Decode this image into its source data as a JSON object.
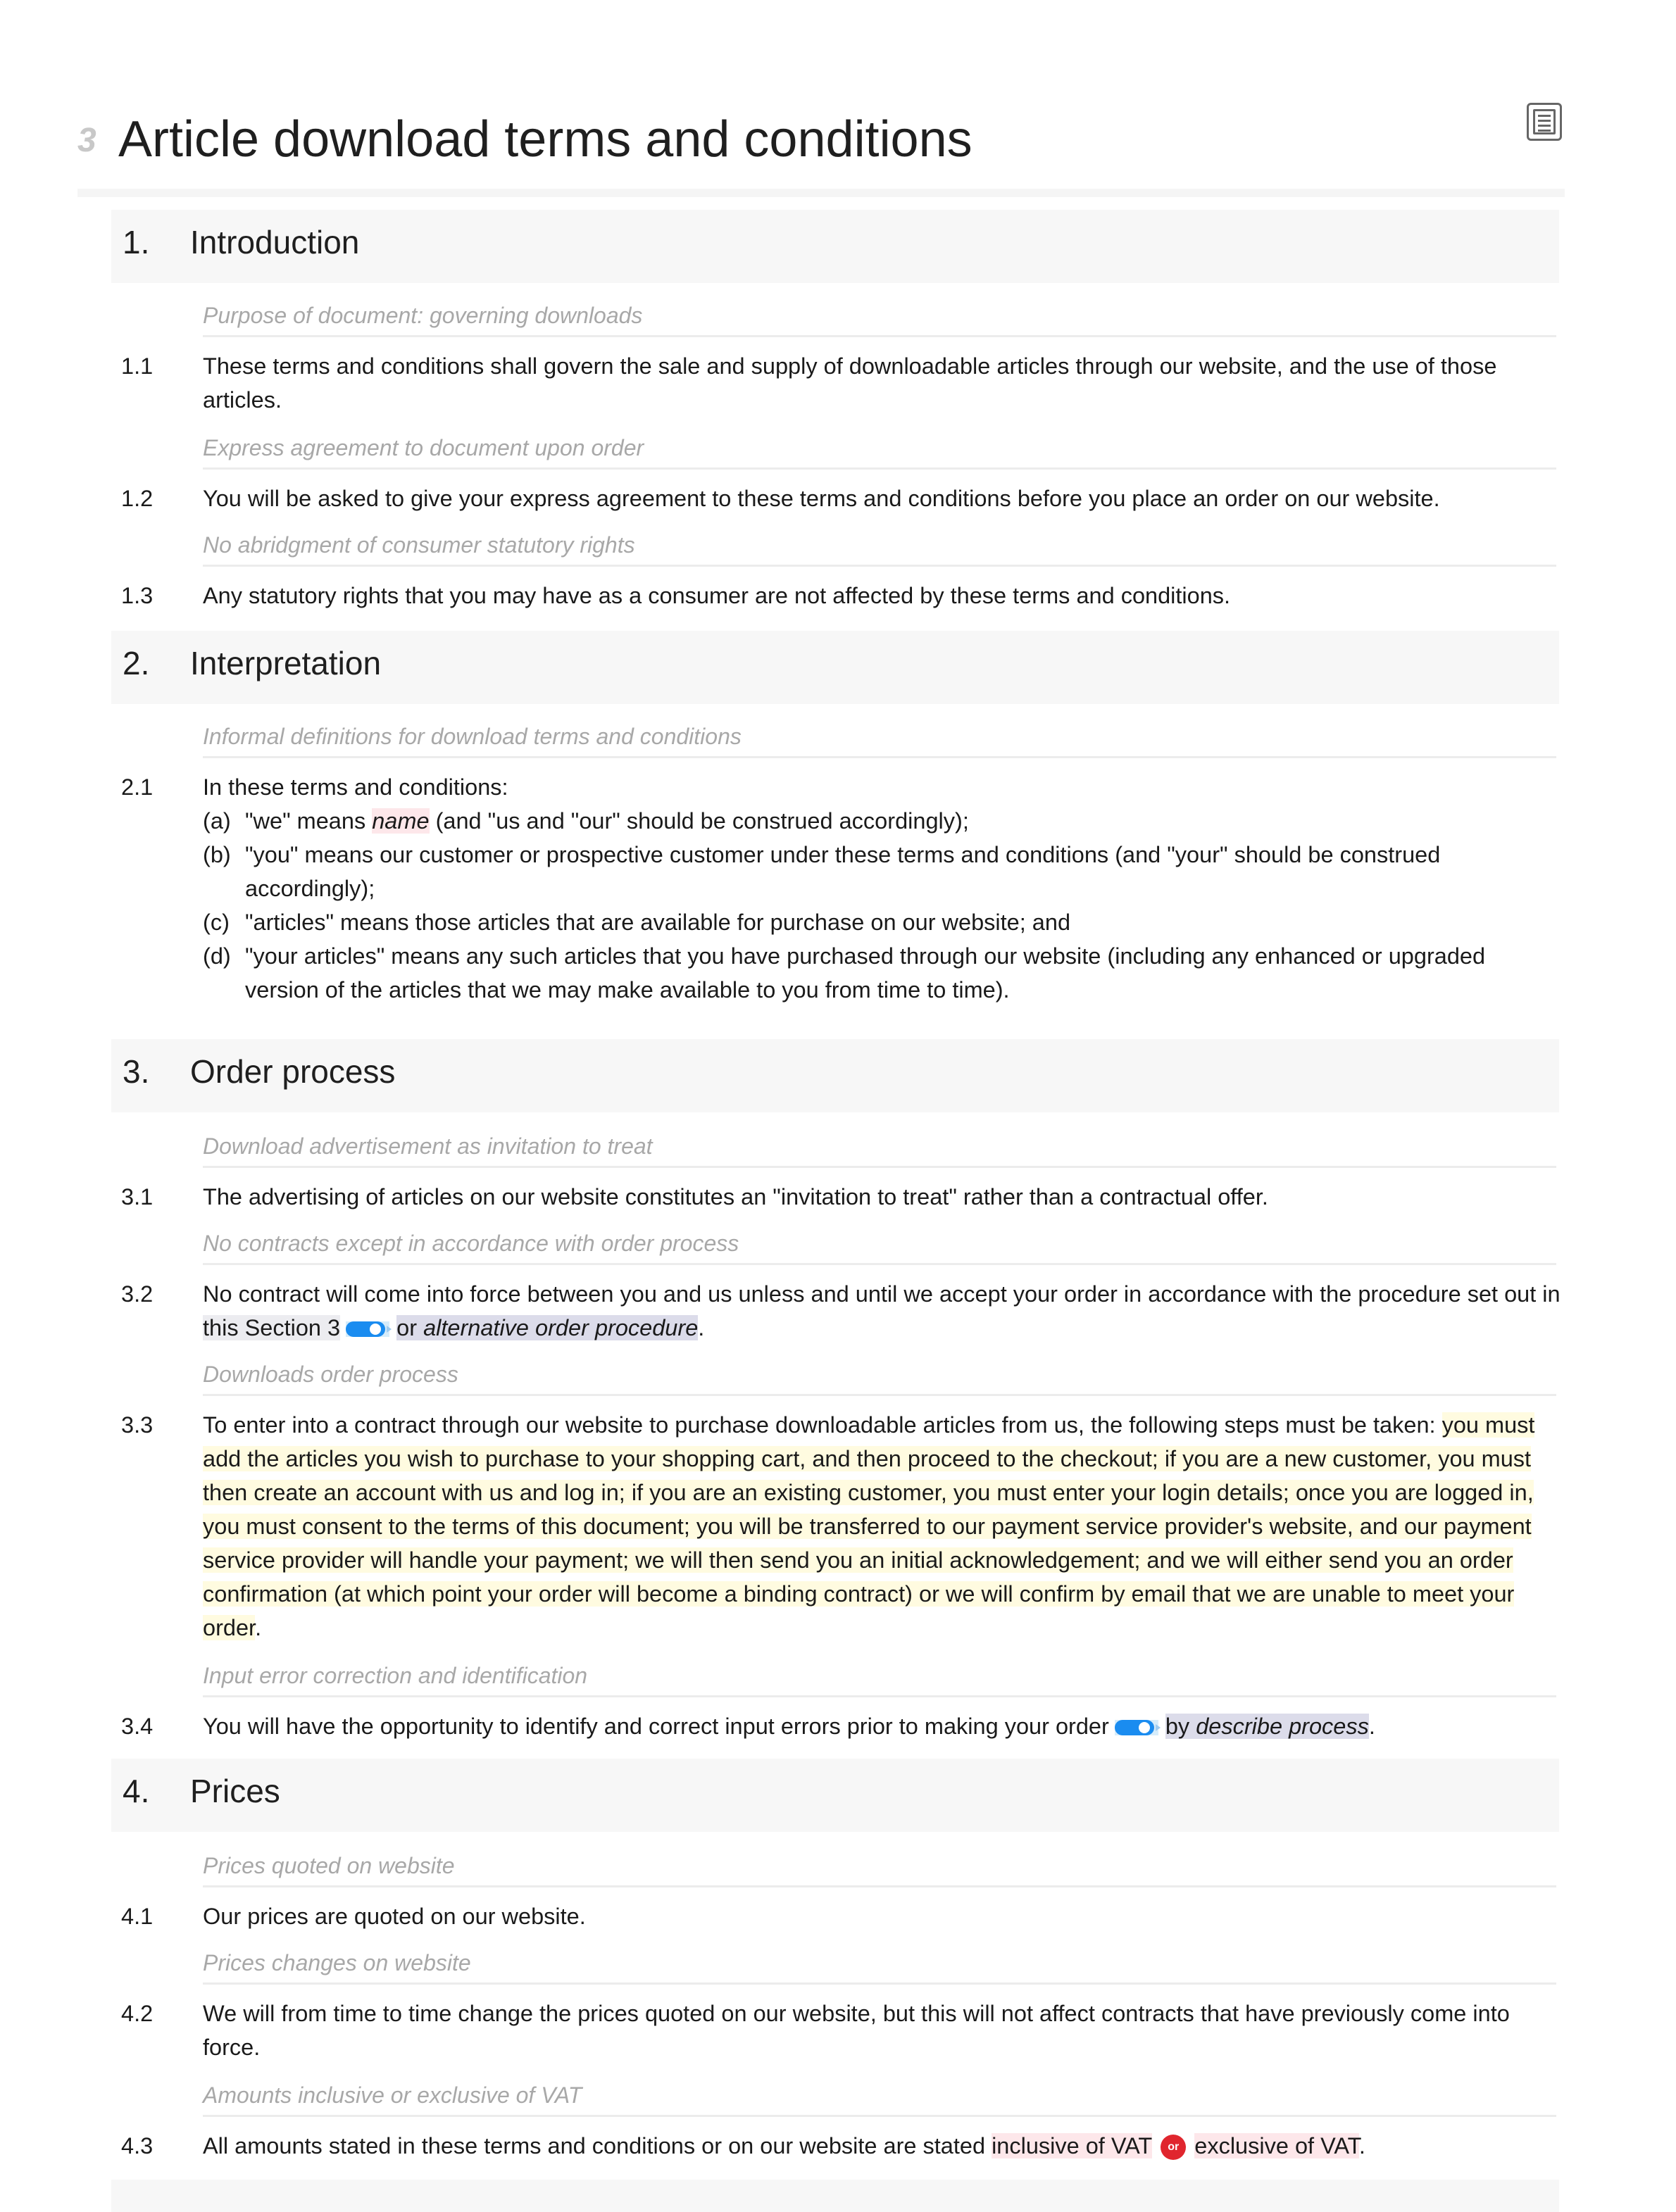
{
  "document": {
    "brand_glyph": "3",
    "title": "Article download terms and conditions",
    "toc_icon": "table-of-contents-icon"
  },
  "sections": [
    {
      "number": "1.",
      "title": "Introduction",
      "clauses": [
        {
          "note": "Purpose of document: governing downloads",
          "number": "1.1",
          "text": "These terms and conditions shall govern the sale and supply of downloadable articles through our website, and the use of those articles."
        },
        {
          "note": "Express agreement to document upon order",
          "number": "1.2",
          "text": "You will be asked to give your express agreement to these terms and conditions before you place an order on our website."
        },
        {
          "note": "No abridgment of consumer statutory rights",
          "number": "1.3",
          "text": "Any statutory rights that you may have as a consumer are not affected by these terms and conditions."
        }
      ]
    },
    {
      "number": "2.",
      "title": "Interpretation",
      "clauses": [
        {
          "note": "Informal definitions for download terms and conditions",
          "number": "2.1",
          "text": "In these terms and conditions:",
          "subclauses": [
            {
              "label": "(a)",
              "before": "\"we\" means ",
              "variable": "name",
              "after": " (and \"us and \"our\" should be construed accordingly);"
            },
            {
              "label": "(b)",
              "text": "\"you\" means our customer or prospective customer under these terms and conditions (and \"your\" should be construed accordingly);"
            },
            {
              "label": "(c)",
              "text": "\"articles\" means those articles that are available for purchase on our website; and"
            },
            {
              "label": "(d)",
              "text": "\"your articles\" means any such articles that you have purchased through our website (including any enhanced or upgraded version of the articles that we may make available to you from time to time)."
            }
          ]
        }
      ]
    },
    {
      "number": "3.",
      "title": "Order process",
      "clauses": [
        {
          "note": "Download advertisement as invitation to treat",
          "number": "3.1",
          "text": "The advertising of articles on our website constitutes an \"invitation to treat\" rather than a contractual offer."
        },
        {
          "note": "No contracts except in accordance with order process",
          "number": "3.2",
          "text_before": "No contract will come into force between you and us unless and until we accept your order in accordance with the procedure set out in ",
          "option_a": "this Section 3",
          "connector": "or",
          "option_b": "alternative order procedure",
          "text_after": "."
        },
        {
          "note": "Downloads order process",
          "number": "3.3",
          "text_before": "To enter into a contract through our website to purchase downloadable articles from us, the following steps must be taken: ",
          "highlighted": "you must add the articles you wish to purchase to your shopping cart, and then proceed to the checkout; if you are a new customer, you must then create an account with us and log in; if you are an existing customer, you must enter your login details; once you are logged in, you must consent to the terms of this document; you will be transferred to our payment service provider's website, and our payment service provider will handle your payment; we will then send you an initial acknowledgement; and we will either send you an order confirmation (at which point your order will become a binding contract) or we will confirm by email that we are unable to meet your order",
          "text_after": "."
        },
        {
          "note": "Input error correction and identification",
          "number": "3.4",
          "text_before": "You will have the opportunity to identify and correct input errors prior to making your order",
          "connector": "by",
          "variable": "describe process",
          "text_after": "."
        }
      ]
    },
    {
      "number": "4.",
      "title": "Prices",
      "clauses": [
        {
          "note": "Prices quoted on website",
          "number": "4.1",
          "text": "Our prices are quoted on our website."
        },
        {
          "note": "Prices changes on website",
          "number": "4.2",
          "text": "We will from time to time change the prices quoted on our website, but this will not affect contracts that have previously come into force."
        },
        {
          "note": "Amounts inclusive or exclusive of VAT",
          "number": "4.3",
          "text_before": "All amounts stated in these terms and conditions or on our website are stated ",
          "option_a": "inclusive of VAT",
          "or_badge": "or",
          "option_b": "exclusive of VAT",
          "text_after": "."
        }
      ]
    }
  ],
  "colors": {
    "toggle_blue": "#1a8cf0",
    "or_badge_red": "#e0262e",
    "note_grey": "#a8a8a8",
    "highlight_yellow": "#fffbe0",
    "highlight_red": "#fde7ea"
  }
}
